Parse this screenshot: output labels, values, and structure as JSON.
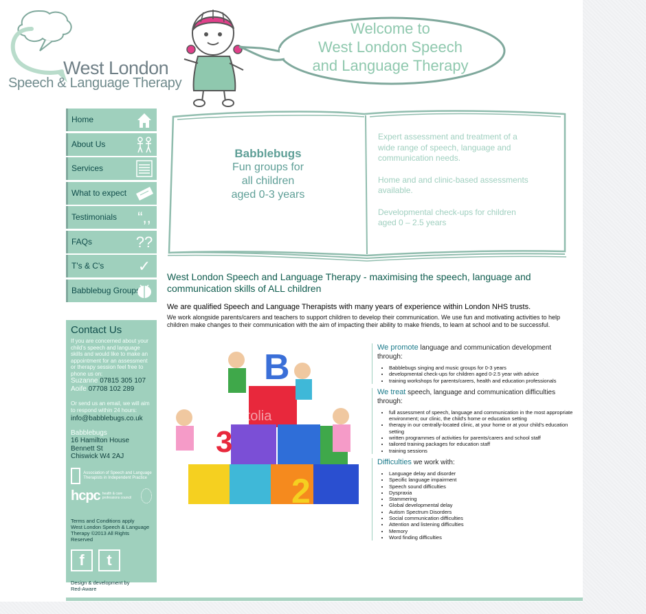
{
  "logo": {
    "title": "West London",
    "subtitle": "Speech & Language Therapy"
  },
  "welcome": {
    "lines": [
      "Welcome to",
      "West London Speech",
      "and Language Therapy"
    ]
  },
  "nav": [
    {
      "label": "Home",
      "icon": "house-icon"
    },
    {
      "label": "About Us",
      "icon": "people-icon"
    },
    {
      "label": "Services",
      "icon": "list-icon"
    },
    {
      "label": "What to expect",
      "icon": "ticket-icon"
    },
    {
      "label": "Testimonials",
      "icon": "quote-icon"
    },
    {
      "label": "FAQs",
      "icon": "question-icon"
    },
    {
      "label": "T's & C's",
      "icon": "check-icon"
    },
    {
      "label": "Babblebug Groups",
      "icon": "ladybird-icon"
    }
  ],
  "contact": {
    "title": "Contact Us",
    "text": "If you are concerned about your child's speech and language skills and would like to make an appointment for an assessment or therapy session feel free to phone us on:",
    "phones": [
      {
        "name": "Suzanne",
        "number": "07815 305 107"
      },
      {
        "name": "Aoife",
        "number": "07708 102 289"
      }
    ],
    "email_text": "Or send us an email, we will aim to respond within 24 hours:",
    "email": "info@babblebugs.co.uk",
    "org": "Babblebugs",
    "address": [
      "16 Hamilton House",
      "Bennett St",
      "Chiswick W4 2AJ"
    ],
    "asl_text": "Association of Speech and Language Therapists in Independent Practice",
    "hcpc": "hcpc",
    "hcpc_small": "health & care professions council",
    "terms": "Terms and Conditions apply",
    "copyright": "West London Speech & Language Therapy ©2013 All Rights Reserved",
    "credit": "Design & development by",
    "credit_link": "Red-Aware"
  },
  "book": {
    "left_title": "Babblebugs",
    "left_lines": [
      "Fun  groups for",
      "all children",
      "aged 0-3 years"
    ],
    "right": [
      "Expert assessment and treatment of a wide range of speech, language and communication needs.",
      "Home and and clinic-based assessments available.",
      "Developmental check-ups for children aged 0 – 2.5 years"
    ]
  },
  "main": {
    "headline": "West London Speech and Language Therapy - maximising the speech, language and communication skills of ALL children",
    "intro": "We are qualified Speech and Language Therapists with many years of experience within London NHS trusts.",
    "intro2": "We work alongside parents/carers and teachers to support children to develop their communication.  We use fun and motivating activities to help children make changes to their communication with the aim of impacting their ability to make friends, to learn at school and to be successful."
  },
  "services": [
    {
      "em": "We promote",
      "rest": " language and communication development through:",
      "items": [
        "Babblebugs singing and music groups for 0-3 years",
        "developmental check-ups for children aged 0-2.5 year with advice",
        "training workshops for parents/carers, health and education professionals"
      ]
    },
    {
      "em": "We treat",
      "rest": " speech, language and communication difficulties through:",
      "items": [
        "full assessment of speech, language and communication in the most appropriate environment; our clinic, the child's home or education setting",
        "therapy in our centrally-located clinic, at your home or at your child's education setting",
        "written programmes of activities for parents/carers and school staff",
        "tailored training packages for education staff",
        "training sessions"
      ]
    },
    {
      "em": "Difficulties",
      "rest": " we work with:",
      "items": [
        "Language delay and disorder",
        "Specific language impairment",
        "Speech sound difficulties",
        "Dyspraxia",
        "Stammering",
        "Global developmental delay",
        "Autism Spectrum Disorders",
        "Social communication difficulties",
        "Attention and listening difficulties",
        "Memory",
        "Word finding difficulties"
      ]
    }
  ],
  "photo": {
    "watermark": "fotolia"
  },
  "colors": {
    "mint": "#9fd0bd",
    "teal_dark": "#0f4c4a",
    "accent": "#1a7a8a"
  }
}
